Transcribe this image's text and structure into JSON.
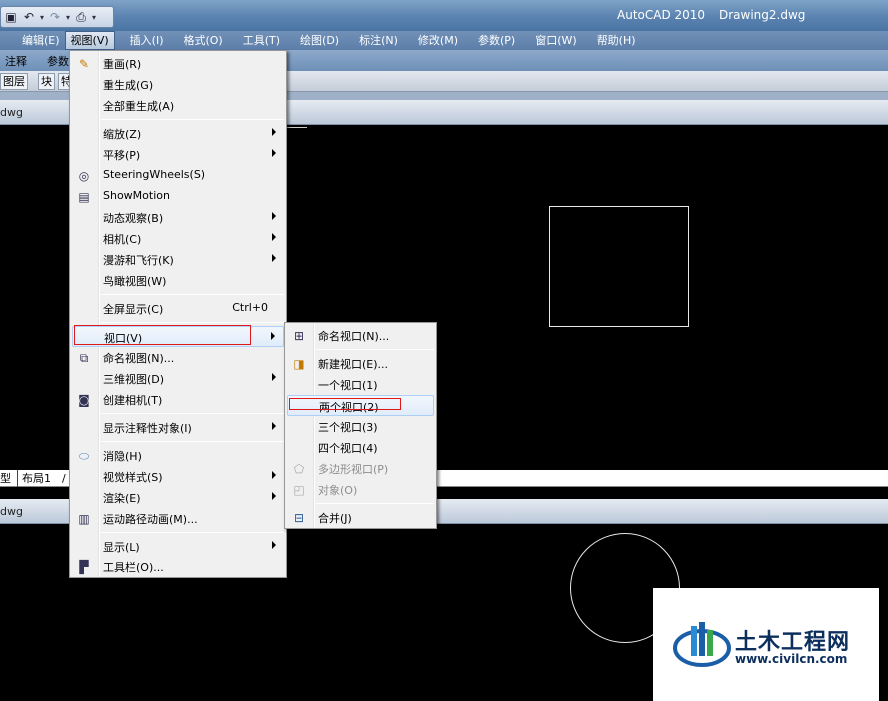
{
  "window": {
    "app_title": "AutoCAD 2010",
    "doc_title": "Drawing2.dwg"
  },
  "menubar": {
    "items": [
      "编辑(E)",
      "视图(V)",
      "插入(I)",
      "格式(O)",
      "工具(T)",
      "绘图(D)",
      "标注(N)",
      "修改(M)",
      "参数(P)",
      "窗口(W)",
      "帮助(H)"
    ],
    "active": "视图(V)"
  },
  "toolbar1": {
    "labels": [
      "注释",
      "参数"
    ]
  },
  "toolbar2": {
    "cells": [
      "图层",
      "块",
      "特"
    ]
  },
  "viewports": {
    "top_name": "dwg",
    "bottom_name": "dwg",
    "layout_tabs": [
      "型",
      "布局1",
      "/"
    ]
  },
  "view_menu": {
    "items": [
      {
        "label": "重画(R)",
        "icon": "pencil-icon"
      },
      {
        "label": "重生成(G)"
      },
      {
        "label": "全部重生成(A)"
      },
      {
        "label": "缩放(Z)",
        "submenu": true
      },
      {
        "label": "平移(P)",
        "submenu": true
      },
      {
        "label": "SteeringWheels(S)",
        "icon": "steering-wheel-icon"
      },
      {
        "label": "ShowMotion",
        "icon": "showmotion-icon"
      },
      {
        "label": "动态观察(B)",
        "submenu": true
      },
      {
        "label": "相机(C)",
        "submenu": true
      },
      {
        "label": "漫游和飞行(K)",
        "submenu": true
      },
      {
        "label": "鸟瞰视图(W)"
      },
      {
        "label": "全屏显示(C)",
        "accelerator": "Ctrl+0"
      },
      {
        "label": "视口(V)",
        "submenu": true
      },
      {
        "label": "命名视图(N)...",
        "icon": "named-view-icon"
      },
      {
        "label": "三维视图(D)",
        "submenu": true
      },
      {
        "label": "创建相机(T)",
        "icon": "camera-icon"
      },
      {
        "label": "显示注释性对象(I)",
        "submenu": true
      },
      {
        "label": "消隐(H)",
        "icon": "hide-icon"
      },
      {
        "label": "视觉样式(S)",
        "submenu": true
      },
      {
        "label": "渲染(E)",
        "submenu": true
      },
      {
        "label": "运动路径动画(M)...",
        "icon": "motion-path-icon"
      },
      {
        "label": "显示(L)",
        "submenu": true
      },
      {
        "label": "工具栏(O)...",
        "icon": "toolbar-icon"
      }
    ]
  },
  "viewport_menu": {
    "items": [
      {
        "label": "命名视口(N)...",
        "icon": "named-viewports-icon"
      },
      {
        "label": "新建视口(E)...",
        "icon": "new-viewport-icon"
      },
      {
        "label": "一个视口(1)"
      },
      {
        "label": "两个视口(2)"
      },
      {
        "label": "三个视口(3)"
      },
      {
        "label": "四个视口(4)"
      },
      {
        "label": "多边形视口(P)",
        "icon": "polygon-viewport-icon",
        "disabled": true
      },
      {
        "label": "对象(O)",
        "icon": "object-viewport-icon",
        "disabled": true
      },
      {
        "label": "合并(J)",
        "icon": "join-icon"
      }
    ]
  },
  "watermark": {
    "title": "土木工程网",
    "url": "www.civilcn.com"
  },
  "colors": {
    "highlight_box": "#e0181a",
    "menu_bg": "#f0f0f0",
    "canvas": "#000000"
  }
}
